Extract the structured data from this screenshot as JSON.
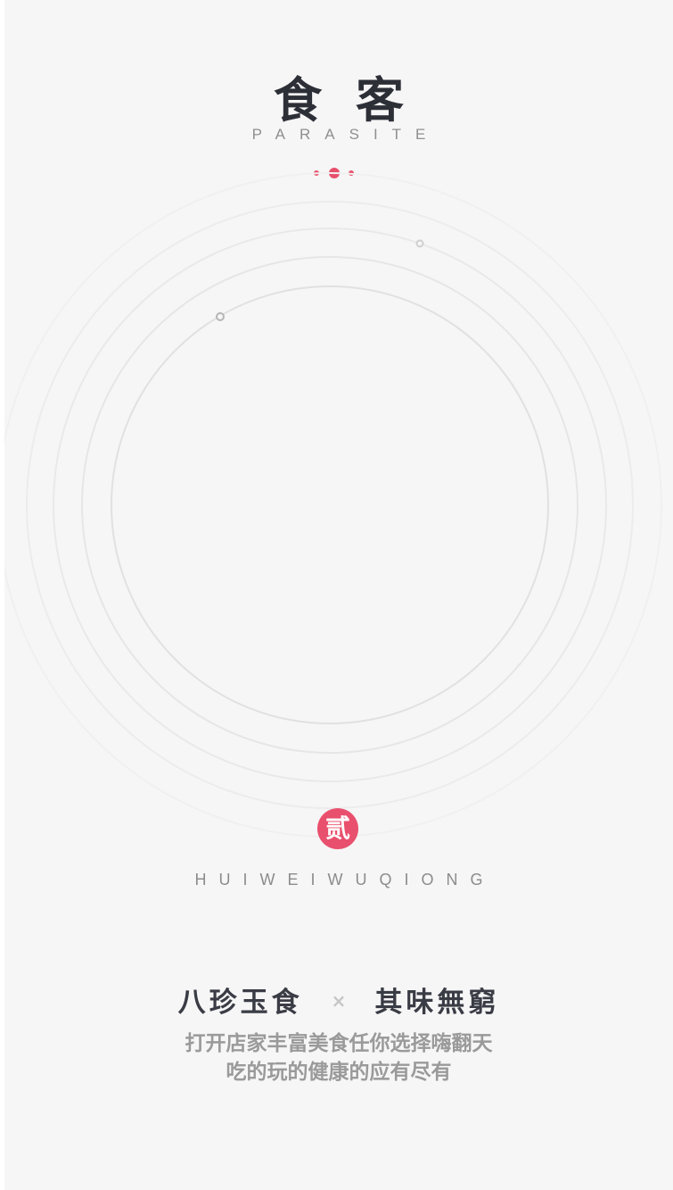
{
  "app": {
    "title": "食客",
    "subtitle": "PARASITE"
  },
  "pager": {
    "total": 3,
    "active_index": 1
  },
  "badge": {
    "text": "贰"
  },
  "pinyin": "HUIWEIWUQIONG",
  "slogan": {
    "left": "八珍玉食",
    "separator": "×",
    "right": "其味無窮"
  },
  "description": {
    "line1": "打开店家丰富美食任你选择嗨翻天",
    "line2": "吃的玩的健康的应有尽有"
  },
  "colors": {
    "accent": "#e8506b",
    "background": "#f6f6f6",
    "title_text": "#2d2f37",
    "muted_text": "#9a9a9a"
  }
}
